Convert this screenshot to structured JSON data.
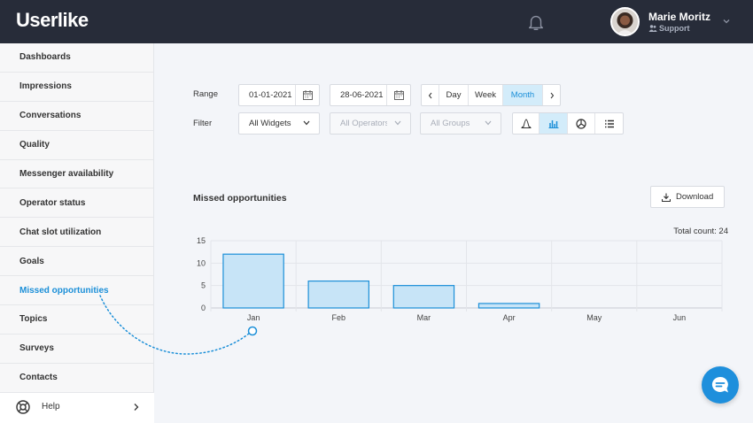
{
  "app": {
    "logo_text": "Userlike"
  },
  "header": {
    "user_name": "Marie Moritz",
    "user_role": "Support",
    "icons": {
      "bell": "bell-icon",
      "user_group": "user-group-icon",
      "menu": "chevron-down-icon"
    }
  },
  "sidebar": {
    "items": [
      {
        "label": "Dashboards",
        "active": false
      },
      {
        "label": "Impressions",
        "active": false
      },
      {
        "label": "Conversations",
        "active": false
      },
      {
        "label": "Quality",
        "active": false
      },
      {
        "label": "Messenger availability",
        "active": false
      },
      {
        "label": "Operator status",
        "active": false
      },
      {
        "label": "Chat slot utilization",
        "active": false
      },
      {
        "label": "Goals",
        "active": false
      },
      {
        "label": "Missed opportunities",
        "active": true
      },
      {
        "label": "Topics",
        "active": false
      },
      {
        "label": "Surveys",
        "active": false
      },
      {
        "label": "Contacts",
        "active": false
      }
    ],
    "help_label": "Help"
  },
  "filters": {
    "range_label": "Range",
    "start_date": "01-01-2021",
    "end_date": "28-06-2021",
    "periods": [
      "Day",
      "Week",
      "Month"
    ],
    "selected_period": "Month",
    "filter_label": "Filter",
    "widgets": "All Widgets",
    "operators": "All Operators",
    "groups": "All Groups",
    "view_modes": [
      "line-chart-icon",
      "bar-chart-icon",
      "pie-chart-icon",
      "list-icon"
    ],
    "selected_view": "bar-chart-icon"
  },
  "report": {
    "title": "Missed opportunities",
    "download_label": "Download",
    "total_count": "Total count: 24"
  },
  "colors": {
    "topbar": "#272c39",
    "accent": "#1b8fd8",
    "bar_fill": "#c7e4f7",
    "bar_stroke": "#1b8fd8",
    "chat_button": "#1e8fdc"
  },
  "chart_data": {
    "type": "bar",
    "categories": [
      "Jan",
      "Feb",
      "Mar",
      "Apr",
      "May",
      "Jun"
    ],
    "values": [
      12,
      6,
      5,
      1,
      0,
      0
    ],
    "yticks": [
      0,
      5,
      10,
      15
    ],
    "ylim": [
      0,
      15
    ],
    "title": "Missed opportunities",
    "xlabel": "",
    "ylabel": "",
    "grid": true
  }
}
